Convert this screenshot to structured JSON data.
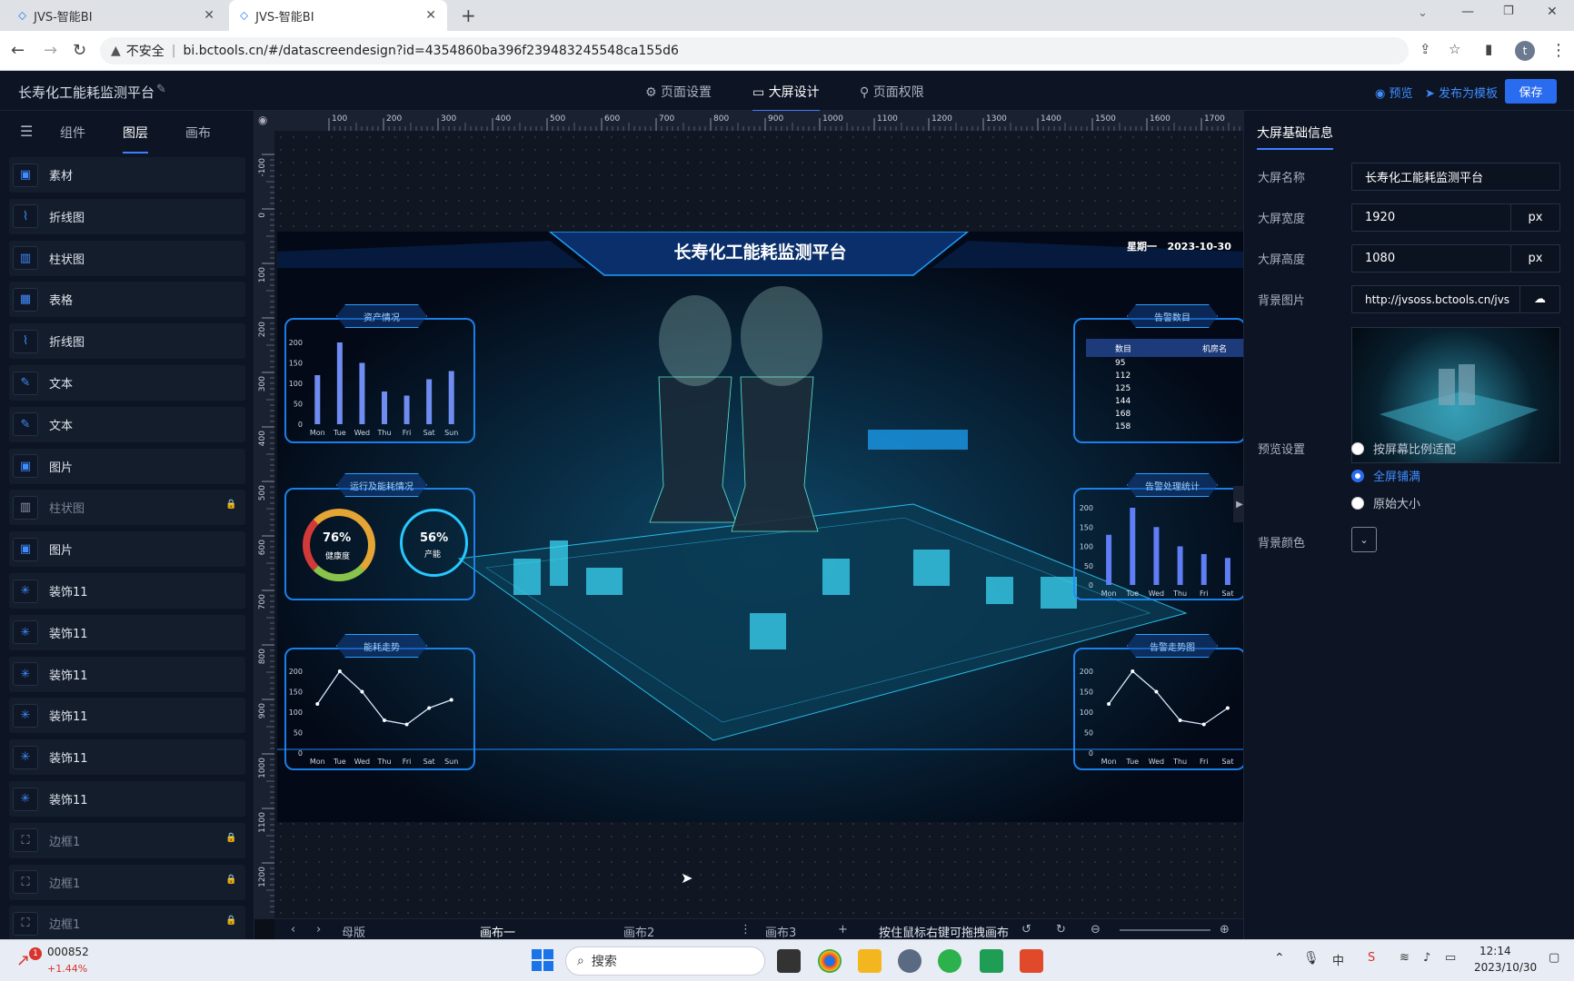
{
  "browser": {
    "tabs": [
      {
        "title": "JVS-智能BI"
      },
      {
        "title": "JVS-智能BI"
      }
    ],
    "security": "不安全",
    "url": "bi.bctools.cn/#/datascreendesign?id=4354860ba396f239483245548ca155d6"
  },
  "app": {
    "title": "长寿化工能耗监测平台",
    "tabs": [
      {
        "label": "页面设置"
      },
      {
        "label": "大屏设计"
      },
      {
        "label": "页面权限"
      }
    ],
    "preview": "预览",
    "publish": "发布为模板",
    "save": "保存"
  },
  "left": {
    "tabs": [
      {
        "label": "组件"
      },
      {
        "label": "图层"
      },
      {
        "label": "画布"
      }
    ],
    "layers": [
      {
        "label": "素材",
        "icon": "image-icon",
        "locked": false
      },
      {
        "label": "折线图",
        "icon": "line-chart-icon",
        "locked": false
      },
      {
        "label": "柱状图",
        "icon": "bar-chart-icon",
        "locked": false
      },
      {
        "label": "表格",
        "icon": "table-icon",
        "locked": false
      },
      {
        "label": "折线图",
        "icon": "line-chart-icon",
        "locked": false
      },
      {
        "label": "文本",
        "icon": "pen-icon",
        "locked": false
      },
      {
        "label": "文本",
        "icon": "pen-icon",
        "locked": false
      },
      {
        "label": "图片",
        "icon": "image-icon",
        "locked": false
      },
      {
        "label": "柱状图",
        "icon": "bar-chart-icon",
        "locked": true
      },
      {
        "label": "图片",
        "icon": "image-icon",
        "locked": false
      },
      {
        "label": "装饰11",
        "icon": "decoration-icon",
        "locked": false
      },
      {
        "label": "装饰11",
        "icon": "decoration-icon",
        "locked": false
      },
      {
        "label": "装饰11",
        "icon": "decoration-icon",
        "locked": false
      },
      {
        "label": "装饰11",
        "icon": "decoration-icon",
        "locked": false
      },
      {
        "label": "装饰11",
        "icon": "decoration-icon",
        "locked": false
      },
      {
        "label": "装饰11",
        "icon": "decoration-icon",
        "locked": false
      },
      {
        "label": "边框1",
        "icon": "border-icon",
        "locked": true
      },
      {
        "label": "边框1",
        "icon": "border-icon",
        "locked": true
      },
      {
        "label": "边框1",
        "icon": "border-icon",
        "locked": true
      }
    ]
  },
  "ruler": {
    "top": [
      "100",
      "200",
      "300",
      "400",
      "500",
      "600",
      "700",
      "800",
      "900",
      "1000",
      "1100",
      "1200",
      "1300",
      "1400",
      "1500",
      "1600",
      "1700"
    ],
    "left": [
      "-100",
      "0",
      "100",
      "200",
      "300",
      "400",
      "500",
      "600",
      "700",
      "800",
      "900",
      "1000",
      "1100",
      "1200"
    ]
  },
  "dashboard": {
    "title": "长寿化工能耗监测平台",
    "weekday": "星期一",
    "date": "2023-10-30",
    "panels": {
      "assets": "资产情况",
      "operation": "运行及能耗情况",
      "energy": "能耗走势",
      "alarm_count": "告警数目",
      "alarm_handle": "告警处理统计",
      "alarm_trend": "告警走势图"
    },
    "gauge1": {
      "value": "76%",
      "label": "健康度"
    },
    "gauge2": {
      "value": "56%",
      "label": "产能"
    },
    "alarm_table": {
      "headers": [
        "数目",
        "机房名"
      ],
      "rows": [
        "95",
        "112",
        "125",
        "144",
        "168",
        "158"
      ]
    },
    "days": [
      "Mon",
      "Tue",
      "Wed",
      "Thu",
      "Fri",
      "Sat",
      "Sun"
    ],
    "bar_yticks": [
      "200",
      "150",
      "100",
      "50",
      "0"
    ],
    "line_yticks": [
      "200",
      "150",
      "100",
      "50",
      "0"
    ]
  },
  "chart_data": [
    {
      "type": "bar",
      "categories": [
        "Mon",
        "Tue",
        "Wed",
        "Thu",
        "Fri",
        "Sat",
        "Sun"
      ],
      "values": [
        120,
        200,
        150,
        80,
        70,
        110,
        130
      ],
      "ylim": [
        0,
        200
      ]
    },
    {
      "type": "line",
      "categories": [
        "Mon",
        "Tue",
        "Wed",
        "Thu",
        "Fri",
        "Sat",
        "Sun"
      ],
      "values": [
        120,
        200,
        150,
        80,
        70,
        110,
        130
      ],
      "ylim": [
        0,
        200
      ]
    },
    {
      "type": "bar",
      "categories": [
        "Mon",
        "Tue",
        "Wed",
        "Thu",
        "Fri",
        "Sat"
      ],
      "values": [
        130,
        200,
        150,
        100,
        80,
        70
      ],
      "ylim": [
        0,
        200
      ]
    },
    {
      "type": "line",
      "categories": [
        "Mon",
        "Tue",
        "Wed",
        "Thu",
        "Fri",
        "Sat"
      ],
      "values": [
        120,
        200,
        150,
        80,
        70,
        110
      ],
      "ylim": [
        0,
        200
      ]
    }
  ],
  "canvas_tabs": {
    "master": "母版",
    "c1": "画布一",
    "c2": "画布2",
    "c3": "画布3",
    "hint": "按住鼠标右键可拖拽画布"
  },
  "right": {
    "section": "大屏基础信息",
    "name_label": "大屏名称",
    "name": "长寿化工能耗监测平台",
    "width_label": "大屏宽度",
    "width": "1920",
    "unit": "px",
    "height_label": "大屏高度",
    "height": "1080",
    "bg_label": "背景图片",
    "bg_url": "http://jvsoss.bctools.cn/jvs",
    "preview_label": "预览设置",
    "options": [
      "按屏幕比例适配",
      "全屏铺满",
      "原始大小"
    ],
    "selected_option": 1,
    "bgcolor_label": "背景颜色"
  },
  "taskbar": {
    "stock_code": "000852",
    "stock_change": "+1.44%",
    "search": "搜索",
    "ime": "中",
    "time": "12:14",
    "date": "2023/10/30"
  },
  "colors": {
    "accent": "#2a6cf0",
    "panel": "#0d1524",
    "cyan": "#1e8cff"
  }
}
